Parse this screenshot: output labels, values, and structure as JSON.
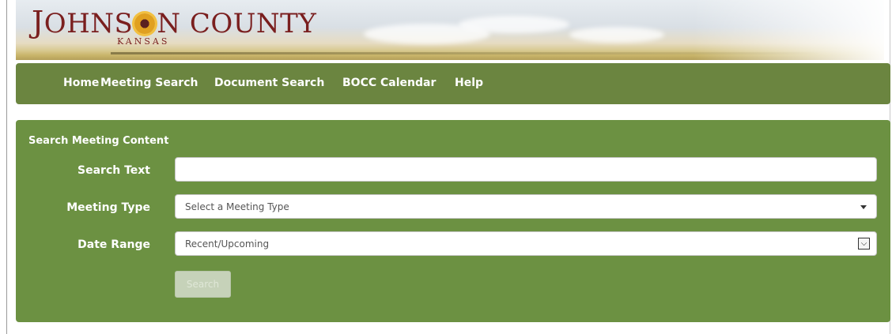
{
  "header": {
    "logo_main_1": "J",
    "logo_main_2": "OHNS",
    "logo_main_3": "N C",
    "logo_main_4": "OUNTY",
    "logo_sub": "KANSAS"
  },
  "nav": {
    "items": [
      {
        "label": "Home"
      },
      {
        "label": "Meeting Search"
      },
      {
        "label": "Document Search"
      },
      {
        "label": "BOCC Calendar"
      },
      {
        "label": "Help"
      }
    ]
  },
  "search_panel": {
    "title": "Search Meeting Content",
    "search_text": {
      "label": "Search Text",
      "value": "",
      "placeholder": ""
    },
    "meeting_type": {
      "label": "Meeting Type",
      "selected": "Select a Meeting Type"
    },
    "date_range": {
      "label": "Date Range",
      "selected": "Recent/Upcoming"
    },
    "search_button": "Search"
  },
  "colors": {
    "nav_bg": "#6b8540",
    "panel_bg": "#6c9142",
    "logo_text": "#7a1f1f"
  }
}
